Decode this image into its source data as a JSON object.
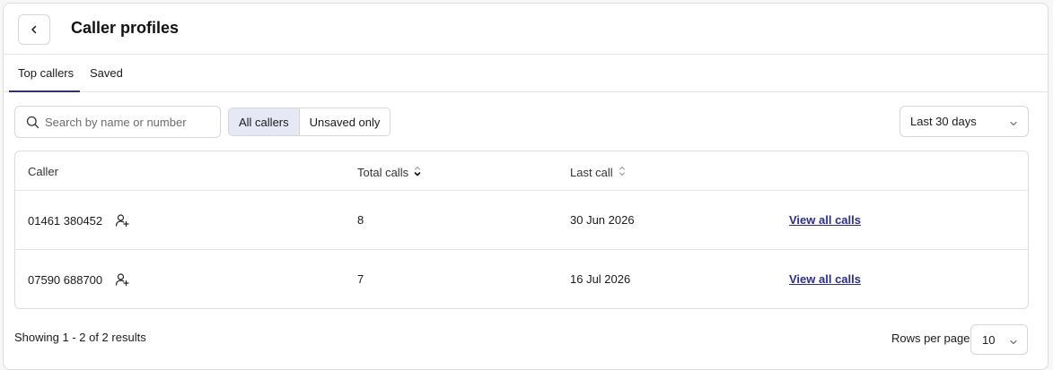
{
  "header": {
    "title": "Caller profiles",
    "back_icon": "chevron-left-icon"
  },
  "tabs": [
    {
      "label": "Top callers",
      "active": true
    },
    {
      "label": "Saved",
      "active": false
    }
  ],
  "filters": {
    "search_placeholder": "Search by name or number",
    "search_value": "",
    "segments": [
      {
        "label": "All callers",
        "selected": true
      },
      {
        "label": "Unsaved only",
        "selected": false
      }
    ],
    "date_range": "Last 30 days"
  },
  "table": {
    "columns": [
      "Caller",
      "Total calls",
      "Last call"
    ],
    "rows": [
      {
        "caller": "01461 380452",
        "total_calls": "8",
        "last_call": "30 Jun 2026",
        "action": "View all calls"
      },
      {
        "caller": "07590 688700",
        "total_calls": "7",
        "last_call": "16 Jul 2026",
        "action": "View all calls"
      }
    ]
  },
  "footer": {
    "summary": "Showing 1 - 2 of 2 results",
    "rows_per_page_label": "Rows per page",
    "rows_per_page_value": "10"
  },
  "colors": {
    "accent": "#2b2e8c",
    "segment_selected": "#e7e8f5",
    "border": "#d6d6d6"
  }
}
